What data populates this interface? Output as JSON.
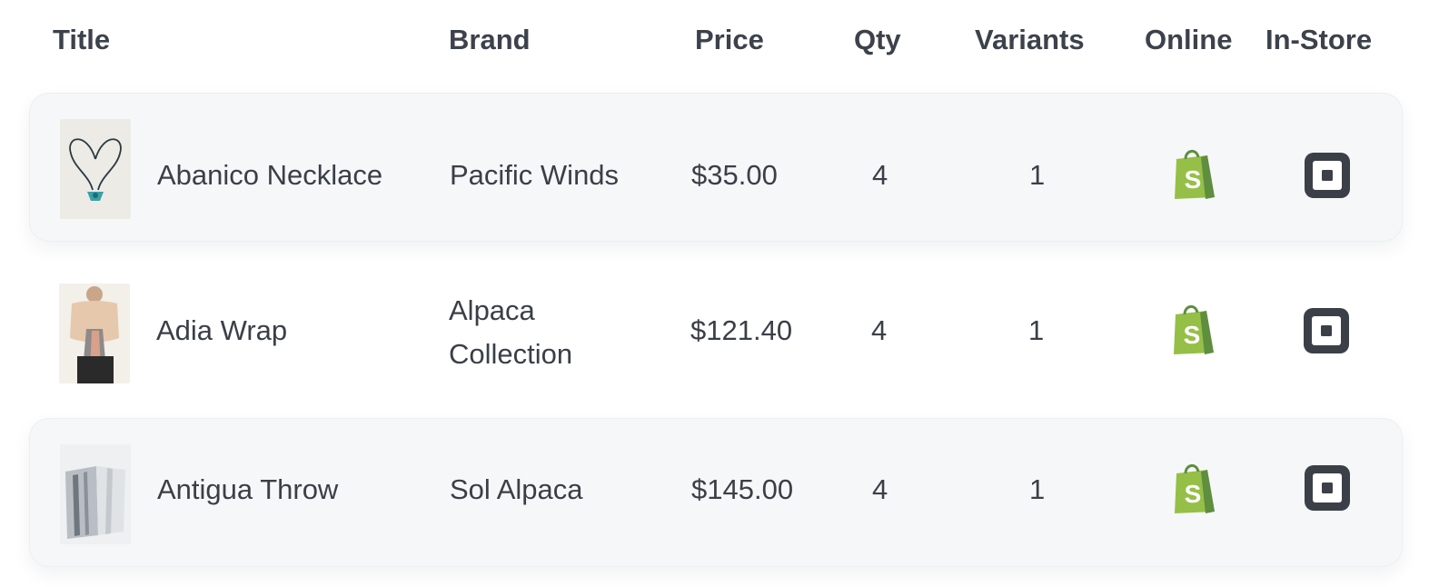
{
  "columns": {
    "title": "Title",
    "brand": "Brand",
    "price": "Price",
    "qty": "Qty",
    "variants": "Variants",
    "online": "Online",
    "instore": "In-Store"
  },
  "rows": [
    {
      "title": "Abanico Necklace",
      "brand": "Pacific Winds",
      "price": "$35.00",
      "qty": "4",
      "variants": "1",
      "online_icon": "shopify-icon",
      "instore_icon": "square-pos-icon",
      "thumb": "necklace-thumbnail"
    },
    {
      "title": "Adia Wrap",
      "brand": "Alpaca Collection",
      "price": "$121.40",
      "qty": "4",
      "variants": "1",
      "online_icon": "shopify-icon",
      "instore_icon": "square-pos-icon",
      "thumb": "wrap-thumbnail"
    },
    {
      "title": "Antigua Throw",
      "brand": "Sol Alpaca",
      "price": "$145.00",
      "qty": "4",
      "variants": "1",
      "online_icon": "shopify-icon",
      "instore_icon": "square-pos-icon",
      "thumb": "throw-thumbnail"
    }
  ],
  "colors": {
    "shopify_green": "#95bf47",
    "shopify_dark_green": "#5e8e3e",
    "square_dark": "#3b4048",
    "row_shade": "#f6f7f9"
  }
}
